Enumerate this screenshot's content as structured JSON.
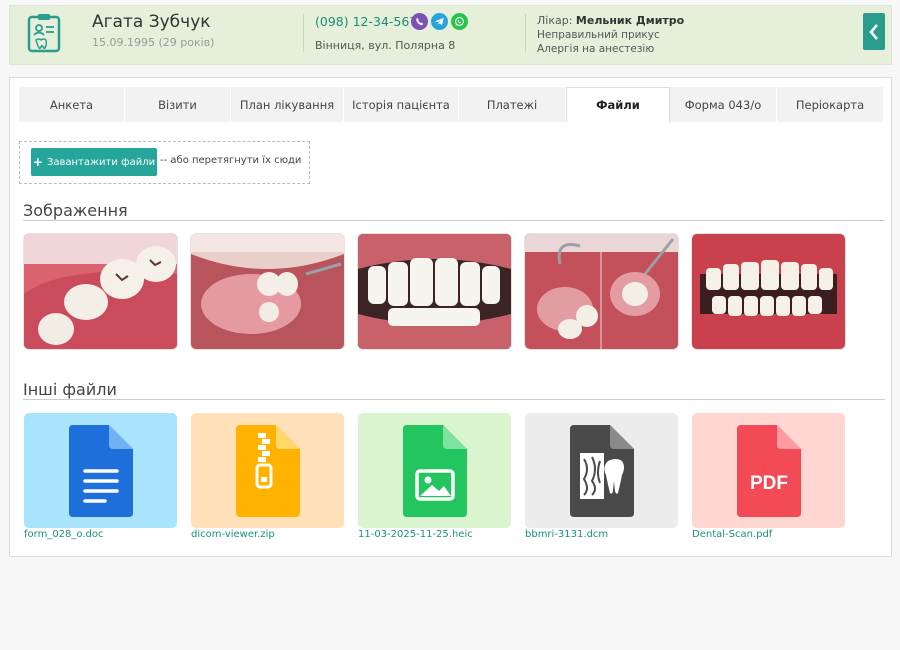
{
  "header": {
    "patient_name": "Агата Зубчук",
    "birth": "15.09.1995 (29 років)",
    "phone": "(098) 12-34-567",
    "messengers": [
      "viber-icon",
      "telegram-icon",
      "whatsapp-icon"
    ],
    "address": "Вінниця, вул. Полярна 8",
    "doctor_label": "Лікар:",
    "doctor_name": "Мельник Дмитро",
    "notes": [
      "Неправильний прикус",
      "Алергія на анестезію"
    ]
  },
  "tabs": [
    {
      "label": "Анкета"
    },
    {
      "label": "Візити"
    },
    {
      "label": "План лікування"
    },
    {
      "label": "Історія пацієнта"
    },
    {
      "label": "Платежі"
    },
    {
      "label": "Файли",
      "active": true
    },
    {
      "label": "Форма 043/о"
    },
    {
      "label": "Періокарта"
    }
  ],
  "upload": {
    "button_label": "Завантажити файли",
    "hint": "-- або перетягнути їх сюди"
  },
  "images_section": {
    "title": "Зображення",
    "images": [
      "dental-photo-1",
      "dental-photo-2",
      "dental-photo-3",
      "dental-photo-4",
      "dental-photo-5"
    ]
  },
  "files_section": {
    "title": "Інші файли",
    "files": [
      {
        "name": "form_028_o.doc",
        "icon": "document-file-icon",
        "bg": "#a8e4fb",
        "color": "#1e6fd9"
      },
      {
        "name": "dicom-viewer.zip",
        "icon": "zip-file-icon",
        "bg": "#ffe0b8",
        "color": "#ffb300"
      },
      {
        "name": "11-03-2025-11-25.heic",
        "icon": "image-file-icon",
        "bg": "#d9f5d0",
        "color": "#22c55e"
      },
      {
        "name": "bbmri-3131.dcm",
        "icon": "dicom-file-icon",
        "bg": "#ececec",
        "color": "#4a4a4a"
      },
      {
        "name": "Dental-Scan.pdf",
        "icon": "pdf-file-icon",
        "bg": "#ffd6d2",
        "color": "#f24b55",
        "badge": "PDF"
      }
    ]
  },
  "colors": {
    "accent": "#26a69a",
    "header_bg": "#e6efda",
    "link": "#1b8f7e"
  }
}
